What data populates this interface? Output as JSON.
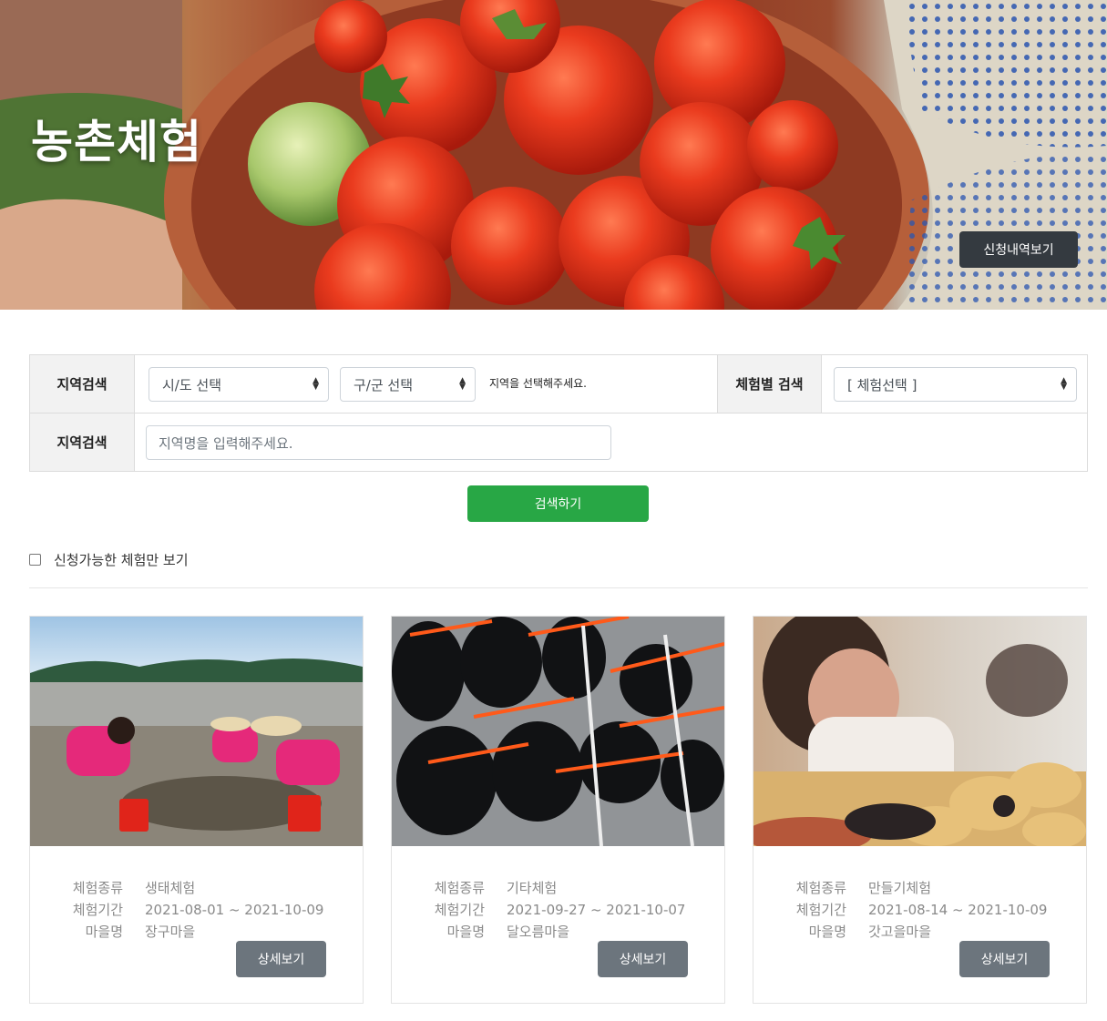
{
  "hero": {
    "title": "농촌체험",
    "history_button": "신청내역보기"
  },
  "search": {
    "region_label": "지역검색",
    "sido_select": "시/도 선택",
    "gugun_select": "구/군 선택",
    "region_hint": "지역을 선택해주세요.",
    "experience_label": "체험별 검색",
    "experience_select": "[ 체험선택 ]",
    "keyword_label": "지역검색",
    "keyword_placeholder": "지역명을 입력해주세요.",
    "submit": "검색하기"
  },
  "filter": {
    "only_available_label": "신청가능한 체험만 보기",
    "only_available_checked": false
  },
  "cards": [
    {
      "type_label": "체험종류",
      "type": "생태체험",
      "period_label": "체험기간",
      "period": "2021-08-01 ~ 2021-10-09",
      "village_label": "마을명",
      "village": "장구마을",
      "button": "상세보기"
    },
    {
      "type_label": "체험종류",
      "type": "기타체험",
      "period_label": "체험기간",
      "period": "2021-09-27 ~ 2021-10-07",
      "village_label": "마을명",
      "village": "달오름마을",
      "button": "상세보기"
    },
    {
      "type_label": "체험종류",
      "type": "만들기체험",
      "period_label": "체험기간",
      "period": "2021-08-14 ~ 2021-10-09",
      "village_label": "마을명",
      "village": "갓고을마을",
      "button": "상세보기"
    }
  ]
}
